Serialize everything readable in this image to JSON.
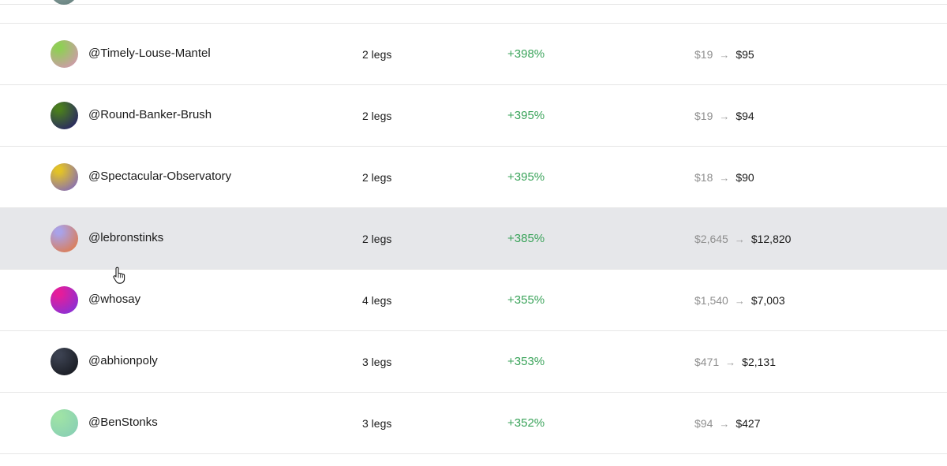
{
  "rows": [
    {
      "username": "@Timely-Louse-Mantel",
      "legs": "2 legs",
      "pct": "+398%",
      "from": "$19",
      "to": "$95",
      "avatar": [
        "#8fcf55",
        "#d992b8"
      ]
    },
    {
      "username": "@Round-Banker-Brush",
      "legs": "2 legs",
      "pct": "+395%",
      "from": "$19",
      "to": "$94",
      "avatar": [
        "#4a7d1e",
        "#241a6e"
      ]
    },
    {
      "username": "@Spectacular-Observatory",
      "legs": "2 legs",
      "pct": "+395%",
      "from": "$18",
      "to": "$90",
      "avatar": [
        "#e2c228",
        "#7a62c8"
      ]
    },
    {
      "username": "@lebronstinks",
      "legs": "2 legs",
      "pct": "+385%",
      "from": "$2,645",
      "to": "$12,820",
      "avatar": [
        "#a9a2e8",
        "#e5763c"
      ]
    },
    {
      "username": "@whosay",
      "legs": "4 legs",
      "pct": "+355%",
      "from": "$1,540",
      "to": "$7,003",
      "avatar": [
        "#e51d9a",
        "#7b34e0"
      ]
    },
    {
      "username": "@abhionpoly",
      "legs": "3 legs",
      "pct": "+353%",
      "from": "$471",
      "to": "$2,131",
      "avatar": [
        "#3b4150",
        "#14161c"
      ]
    },
    {
      "username": "@BenStonks",
      "legs": "3 legs",
      "pct": "+352%",
      "from": "$94",
      "to": "$427",
      "avatar": [
        "#9ee2a6",
        "#86cdb6"
      ]
    }
  ],
  "hovered_row": 3,
  "colors": {
    "positive": "#3aa35a",
    "muted": "#8f8f8f",
    "hover": "#e6e7ea"
  },
  "icons": {
    "arrow": "arrow-right-icon",
    "cursor": "hand-pointer-icon"
  }
}
